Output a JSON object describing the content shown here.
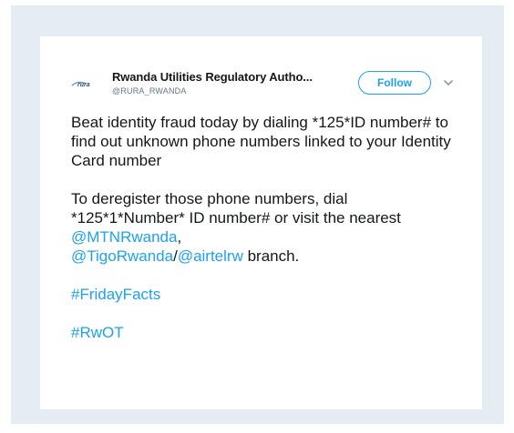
{
  "tweet": {
    "author_name": "Rwanda Utilities Regulatory Autho...",
    "author_handle": "@RURA_RWANDA",
    "logo_text": "rura",
    "follow_label": "Follow",
    "para1": "Beat identity fraud today by dialing *125*ID number# to find out unknown phone numbers linked to your Identity Card number",
    "para2_a": "To deregister those phone numbers, dial *125*1*Number* ID number# or visit the nearest ",
    "mention_mtn": "@MTNRwanda",
    "para2_comma": ",",
    "mention_tigo": "@TigoRwanda",
    "para2_slash": "/",
    "mention_airtel": "@airtelrw",
    "para2_b": " branch.",
    "hashtag1": "#FridayFacts",
    "hashtag2": "#RwOT"
  },
  "colors": {
    "frame_bg": "#e5ecf4",
    "card_bg": "#ffffff",
    "link": "#1da1f2",
    "text": "#14171a",
    "muted": "#657786"
  },
  "icons": {
    "logo": "rura-logo",
    "caret": "chevron-down-icon"
  }
}
